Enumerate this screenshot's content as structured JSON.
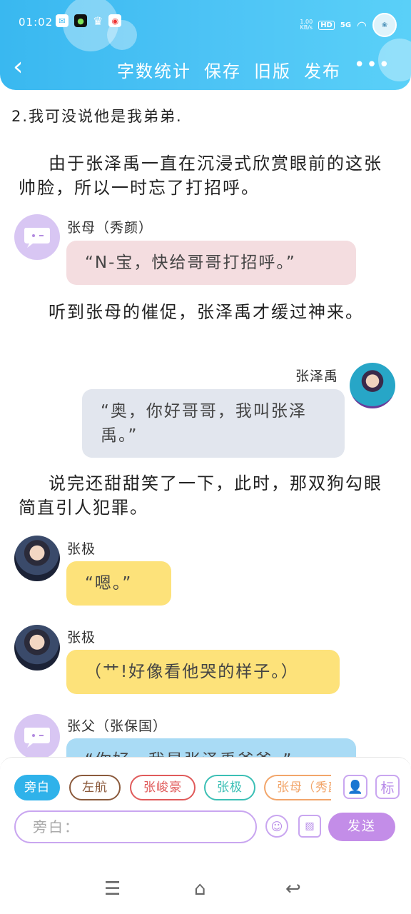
{
  "status_bar": {
    "time": "01:02",
    "net_speed_value": "1.00",
    "net_speed_unit": "KB/s",
    "hd": "HD",
    "signal": "5G"
  },
  "nav": {
    "actions": [
      "字数统计",
      "保存",
      "旧版",
      "发布"
    ],
    "more": "•••"
  },
  "content": {
    "line1": "2.我可没说他是我弟弟.",
    "para1": "由于张泽禹一直在沉浸式欣赏眼前的这张帅脸，所以一时忘了打招呼。",
    "msg1_name": "张母（秀颜）",
    "msg1_text": "“N-宝，快给哥哥打招呼。”",
    "para2": "听到张母的催促，张泽禹才缓过神来。",
    "msg2_name": "张泽禹",
    "msg2_text": "“奥，你好哥哥，我叫张泽禹。”",
    "para3": "说完还甜甜笑了一下，此时，那双狗勾眼简直引人犯罪。",
    "msg3_name": "张极",
    "msg3_text": "“嗯。”",
    "msg4_name": "张极",
    "msg4_text": "（艹!好像看他哭的样子。）",
    "msg5_name": "张父（张保国）",
    "msg5_text": "“你好，我是张泽禹爸爸。”"
  },
  "panel": {
    "chips": [
      "旁白",
      "左航",
      "张峻豪",
      "张极",
      "张母（秀颜）"
    ],
    "tag_icon": "标",
    "input_placeholder": "旁白：",
    "send_label": "发送"
  },
  "colors": {
    "header": "#3fbdf3",
    "msg1_bg": "#f4dde0",
    "msg2_bg": "#e2e6ee",
    "msg3_bg": "#fde27a",
    "msg5_bg": "#a9dbf5",
    "accent_purple": "#c38de8",
    "chip_blue": "#2fb2ea",
    "chip_brown": "#8b5a3c",
    "chip_red": "#e05a5a",
    "chip_teal": "#3bbfb5",
    "chip_orange": "#f2a56a"
  }
}
